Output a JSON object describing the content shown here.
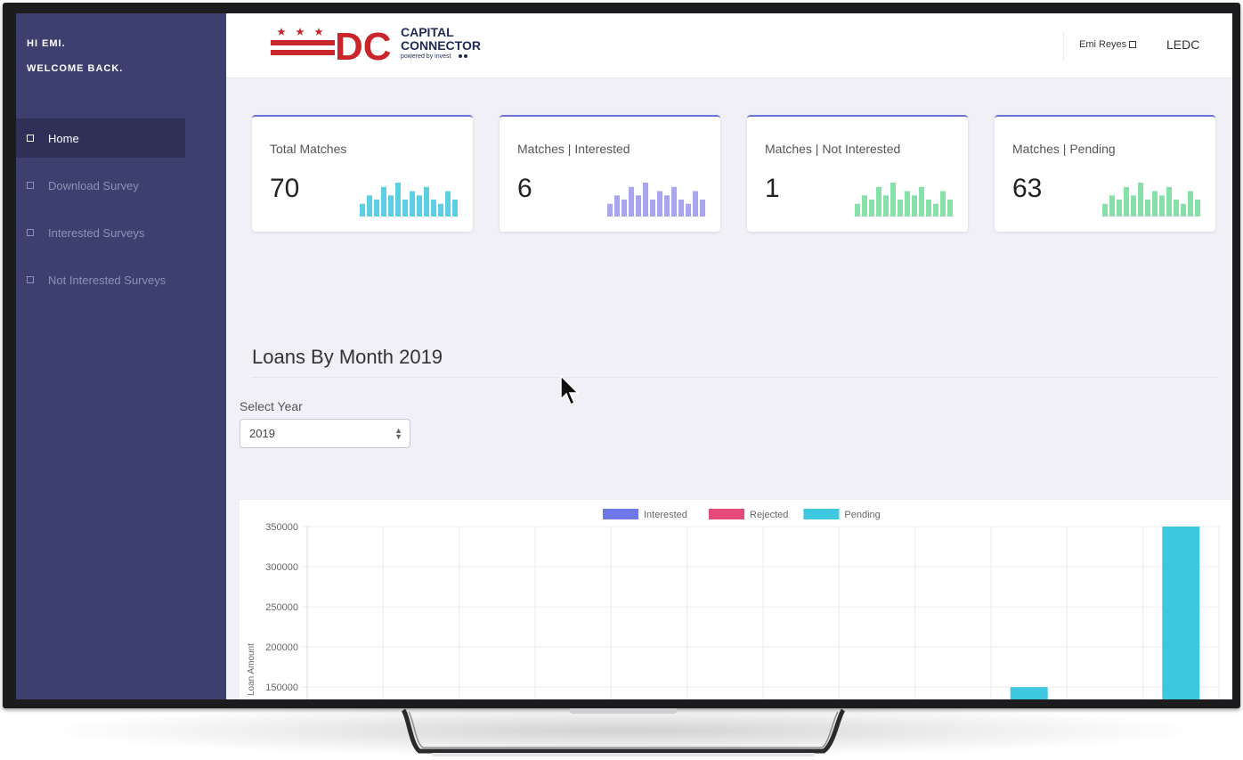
{
  "sidebar": {
    "greeting_line1": "HI EMI.",
    "greeting_line2": "WELCOME BACK.",
    "items": [
      {
        "label": "Home",
        "active": true
      },
      {
        "label": "Download Survey",
        "active": false
      },
      {
        "label": "Interested Surveys",
        "active": false
      },
      {
        "label": "Not Interested Surveys",
        "active": false
      }
    ]
  },
  "header": {
    "logo_letters": "DC",
    "logo_line1": "CAPITAL",
    "logo_line2": "CONNECTOR",
    "logo_tagline": "powered by invest",
    "user_name": "Emi Reyes",
    "org": "LEDC"
  },
  "cards": [
    {
      "title": "Total Matches",
      "value": "70",
      "spark_color": "#5ccfe0"
    },
    {
      "title": "Matches | Interested",
      "value": "6",
      "spark_color": "#a9a6ee"
    },
    {
      "title": "Matches | Not Interested",
      "value": "1",
      "spark_color": "#86e0a8"
    },
    {
      "title": "Matches | Pending",
      "value": "63",
      "spark_color": "#86e0a8"
    }
  ],
  "spark_values": [
    3,
    5,
    4,
    7,
    5,
    8,
    4,
    6,
    5,
    7,
    4,
    3,
    6,
    4
  ],
  "section": {
    "title": "Loans By Month 2019",
    "select_label": "Select Year",
    "select_value": "2019"
  },
  "colors": {
    "sidebar_bg": "#3d3f6e",
    "accent": "#6b73d6",
    "logo_red": "#c8262b",
    "logo_navy": "#1f2a55"
  },
  "chart_data": {
    "type": "bar",
    "legend_position": "top-center",
    "ylabel": "Loan Amount",
    "y_ticks": [
      150000,
      200000,
      250000,
      300000,
      350000
    ],
    "ylim_visible": [
      128000,
      350000
    ],
    "category_count": 12,
    "series": [
      {
        "name": "Interested",
        "color": "#6e78e8",
        "values": [
          0,
          0,
          0,
          0,
          0,
          0,
          0,
          0,
          0,
          0,
          0,
          0
        ]
      },
      {
        "name": "Rejected",
        "color": "#e54b7a",
        "values": [
          0,
          0,
          0,
          0,
          0,
          0,
          0,
          0,
          0,
          0,
          0,
          0
        ]
      },
      {
        "name": "Pending",
        "color": "#3ec8df",
        "values": [
          0,
          0,
          0,
          0,
          0,
          0,
          0,
          0,
          0,
          150000,
          0,
          350000
        ]
      }
    ]
  }
}
